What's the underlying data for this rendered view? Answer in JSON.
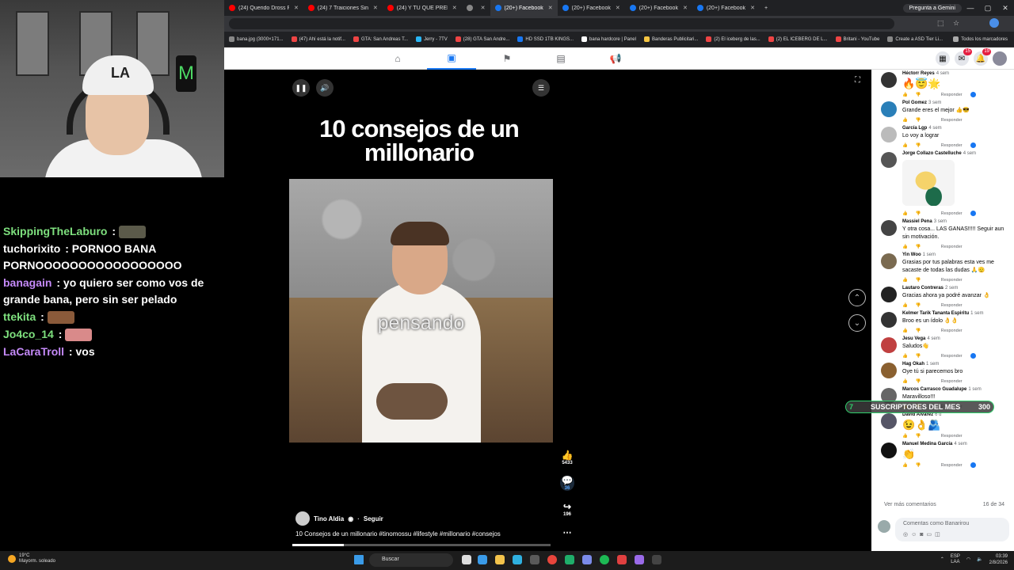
{
  "webcam": {
    "cap_logo": "LA",
    "can_logo": "M"
  },
  "chat": [
    {
      "user": "SkippingTheLaburo",
      "text": "",
      "color": "#7ee07e",
      "emote": "#5b5a4a"
    },
    {
      "user": "tuchorixito",
      "text": "PORNOO BANA PORNOOOOOOOOOOOOOOOOO",
      "color": "#ffffff",
      "emote": ""
    },
    {
      "user": "banagain",
      "text": "yo quiero ser como vos de grande bana, pero sin ser pelado",
      "color": "#c58af9",
      "emote": ""
    },
    {
      "user": "ttekita",
      "text": "",
      "color": "#7ee07e",
      "emote": "#8a5a3a"
    },
    {
      "user": "Jo4co_14",
      "text": "",
      "color": "#7ee07e",
      "emote": "#d98a8a"
    },
    {
      "user": "LaCaraTroll",
      "text": "vos",
      "color": "#c58af9",
      "emote": ""
    }
  ],
  "tabs": [
    {
      "label": "(24) Querido Dross RU",
      "color": "#ff0000",
      "active": false
    },
    {
      "label": "(24) 7 Traiciones Sinie",
      "color": "#ff0000",
      "active": false
    },
    {
      "label": "(24) Y TU QUE PREFIER",
      "color": "#ff0000",
      "active": false
    },
    {
      "label": "",
      "color": "#888888",
      "active": false
    },
    {
      "label": "(20+) Facebook",
      "color": "#1877f2",
      "active": true
    },
    {
      "label": "(20+) Facebook",
      "color": "#1877f2",
      "active": false
    },
    {
      "label": "(20+) Facebook",
      "color": "#1877f2",
      "active": false
    },
    {
      "label": "(20+) Facebook",
      "color": "#1877f2",
      "active": false
    }
  ],
  "gemini_label": "Pregunta a Gemini",
  "bookmarks": [
    {
      "label": "bana.jpg (3000×171...",
      "color": "#888"
    },
    {
      "label": "(47) Ahí está la notif...",
      "color": "#e44"
    },
    {
      "label": "GTA: San Andreas T...",
      "color": "#e44"
    },
    {
      "label": "Jerry - 7TV",
      "color": "#29b6f6"
    },
    {
      "label": "(28) GTA San Andre...",
      "color": "#e44"
    },
    {
      "label": "HD SSD 1TB KINGS...",
      "color": "#1877f2"
    },
    {
      "label": "bana hardcore | Panel",
      "color": "#fff"
    },
    {
      "label": "Banderas Publicitari...",
      "color": "#f5c542"
    },
    {
      "label": "(2) El iceberg de las...",
      "color": "#e44"
    },
    {
      "label": "(2) EL ICEBERG DE L...",
      "color": "#e44"
    },
    {
      "label": "Britani - YouTube",
      "color": "#e44"
    },
    {
      "label": "Create a ASD Tier Li...",
      "color": "#888"
    }
  ],
  "all_bookmarks_label": "Todos los marcadores",
  "fb": {
    "nav": [
      "home-icon",
      "video-icon",
      "flag-icon",
      "marketplace-icon",
      "megaphone-icon"
    ],
    "messenger_badge": "15",
    "notif_badge": "19"
  },
  "video": {
    "title": "10 consejos de un millonario",
    "caption": "pensando",
    "author": "Tino Aldia",
    "follow": "Seguir",
    "description": "10 Consejos de un millonario #tinomossu #lifestyle #millonario #consejos",
    "progress": 0.2,
    "likes": "5433",
    "comments": "36",
    "shares": "196"
  },
  "comments": [
    {
      "name": "Héctorr Reyes",
      "age": "4 sem",
      "text": "🔥😇🌟",
      "big": true,
      "color": "#333",
      "dot": true
    },
    {
      "name": "Pol Gomez",
      "age": "3 sem",
      "text": "Grande eres el mejor 👍😎",
      "big": false,
      "color": "#2a7fb8",
      "dot": false
    },
    {
      "name": "García Lgp",
      "age": "4 sem",
      "text": "Lo voy a lograr",
      "big": false,
      "color": "#bbb",
      "dot": true
    },
    {
      "name": "Jorge Collazo Castelluche",
      "age": "4 sem",
      "text": "",
      "big": false,
      "color": "#555",
      "dot": true,
      "sticker": true
    },
    {
      "name": "Massiel Pena",
      "age": "3 sem",
      "text": "Y otra cosa... LAS GANAS!!!!! Seguir aun sin motivación.",
      "big": false,
      "color": "#444",
      "dot": false
    },
    {
      "name": "Yin Woo",
      "age": "1 sem",
      "text": "Grasias por tus palabras esta ves me sacaste de todas las dudas 🙏🫡",
      "big": false,
      "color": "#7a6a50",
      "dot": false
    },
    {
      "name": "Lautaro Contreras",
      "age": "2 sem",
      "text": "Gracias ahora ya podré avanzar 👌",
      "big": false,
      "color": "#222",
      "dot": false
    },
    {
      "name": "Kelmer Tarik Tananta Espiritu",
      "age": "1 sem",
      "text": "Broo es un ídolo 👌👌",
      "big": false,
      "color": "#333",
      "dot": false
    },
    {
      "name": "Jesu Vega",
      "age": "4 sem",
      "text": "Saludos👋",
      "big": false,
      "color": "#c04040",
      "dot": true
    },
    {
      "name": "Hag Okah",
      "age": "1 sem",
      "text": "Oye tú si parecemos bro",
      "big": false,
      "color": "#8a6030",
      "dot": false
    },
    {
      "name": "Marcos Carrasco Guadalupe",
      "age": "1 sem",
      "text": "Maravilloso!!!",
      "big": false,
      "color": "#666",
      "dot": false
    },
    {
      "name": "David Alvarez",
      "age": "6 d",
      "text": "😉👌🫂",
      "big": true,
      "color": "#556",
      "dot": false
    },
    {
      "name": "Manuel Medina García",
      "age": "4 sem",
      "text": "👏",
      "big": true,
      "color": "#111",
      "dot": true
    }
  ],
  "reply_label": "Responder",
  "more_comments": "Ver más comentarios",
  "comment_count": "16 de 34",
  "composer_placeholder": "Comentas como Banarirou",
  "subs": {
    "number": "7",
    "label": "SUSCRIPTORES DEL MES",
    "count": "300"
  },
  "taskbar": {
    "weather_temp": "19°C",
    "weather_desc": "Mayorm. soleado",
    "search": "Buscar",
    "lang": "ESP",
    "lang2": "LAA",
    "time": "03:39",
    "date": "2/8/2026"
  }
}
